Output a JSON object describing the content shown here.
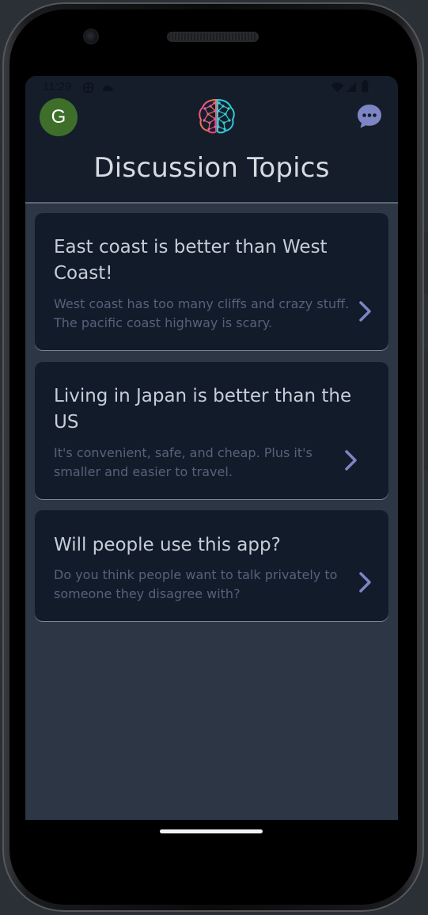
{
  "status_bar": {
    "time": "11:29"
  },
  "header": {
    "avatar_initial": "G",
    "title": "Discussion Topics"
  },
  "topics": [
    {
      "title": "East coast is better than West Coast!",
      "description": "West coast has too many cliffs and crazy stuff.  The pacific coast highway is scary."
    },
    {
      "title": "Living in Japan is better than the US",
      "description": "It's convenient, safe, and cheap. Plus it's smaller and easier to travel."
    },
    {
      "title": "Will people use this app?",
      "description": "Do you think people want to talk privately to someone they disagree with?"
    }
  ],
  "colors": {
    "avatar_bg": "#3e6f2a",
    "header_bg": "#151d2b",
    "card_bg": "#111b2a",
    "accent": "#7e85c4",
    "screen_bg": "#2d3644"
  },
  "icons": {
    "logo": "brain-icon",
    "chat": "chat-bubble-icon",
    "chevron": "chevron-right-icon",
    "wifi": "wifi-icon",
    "signal": "signal-icon",
    "battery": "battery-icon"
  }
}
